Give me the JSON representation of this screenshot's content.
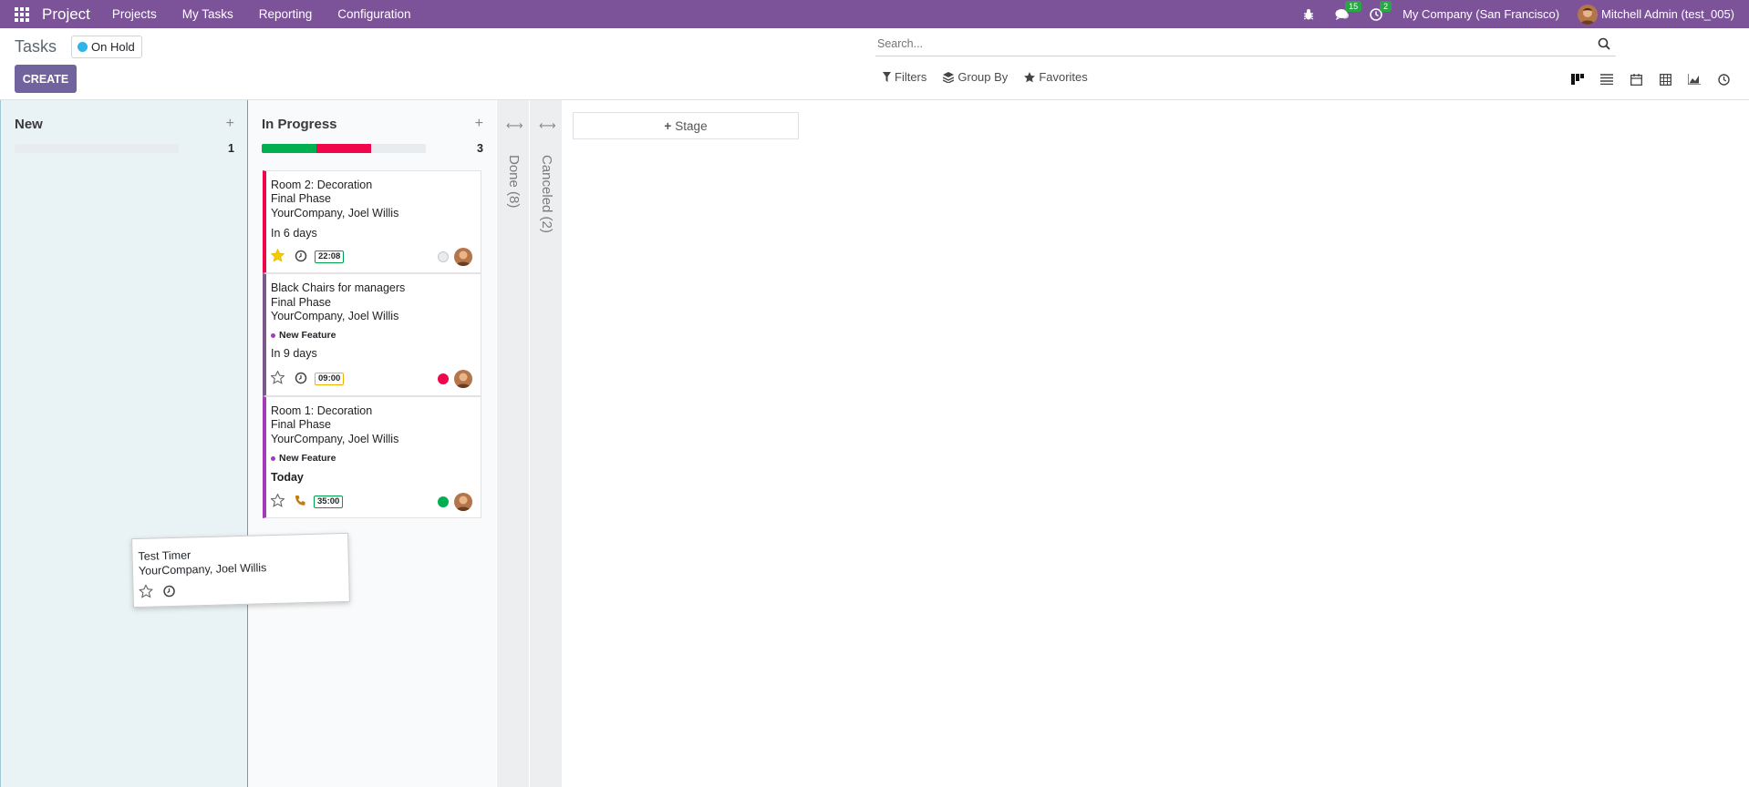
{
  "navbar": {
    "brand": "Project",
    "menus": [
      "Projects",
      "My Tasks",
      "Reporting",
      "Configuration"
    ],
    "messages_badge": "15",
    "activities_badge": "2",
    "company": "My Company (San Francisco)",
    "user": "Mitchell Admin (test_005)"
  },
  "control_panel": {
    "title": "Tasks",
    "filter_facet": "On Hold",
    "create_label": "CREATE",
    "search_placeholder": "Search...",
    "filters_label": "Filters",
    "groupby_label": "Group By",
    "favorites_label": "Favorites"
  },
  "kanban": {
    "columns": [
      {
        "name": "New",
        "count": "1",
        "progress": {
          "ok": 0,
          "blocked": 0
        }
      },
      {
        "name": "In Progress",
        "count": "3",
        "progress": {
          "ok": 0.333,
          "blocked": 0.333
        }
      }
    ],
    "folded": [
      {
        "label": "Done (8)"
      },
      {
        "label": "Canceled (2)"
      }
    ],
    "add_stage_label": "Stage",
    "cards": [
      {
        "title": "Room 2: Decoration",
        "subtitle": "Final Phase",
        "customer": "YourCompany, Joel Willis",
        "tag": "",
        "deadline": "In 6 days",
        "timer": "22:08",
        "starred": true,
        "state": "normal",
        "accent": "#f0064a"
      },
      {
        "title": "Black Chairs for managers",
        "subtitle": "Final Phase",
        "customer": "YourCompany, Joel Willis",
        "tag": "New Feature",
        "deadline": "In 9 days",
        "timer": "09:00",
        "starred": false,
        "state": "blocked",
        "accent": "#7a5a8c"
      },
      {
        "title": "Room 1: Decoration",
        "subtitle": "Final Phase",
        "customer": "YourCompany, Joel Willis",
        "tag": "New Feature",
        "deadline": "Today",
        "timer": "35:00",
        "starred": false,
        "state": "done",
        "accent": "#a23cb8"
      }
    ],
    "dragged_card": {
      "title": "Test Timer",
      "customer": "YourCompany, Joel Willis"
    }
  },
  "colors": {
    "navbar": "#7c5399",
    "create": "#71639e",
    "ok": "#00b050",
    "blocked": "#f0064a"
  }
}
